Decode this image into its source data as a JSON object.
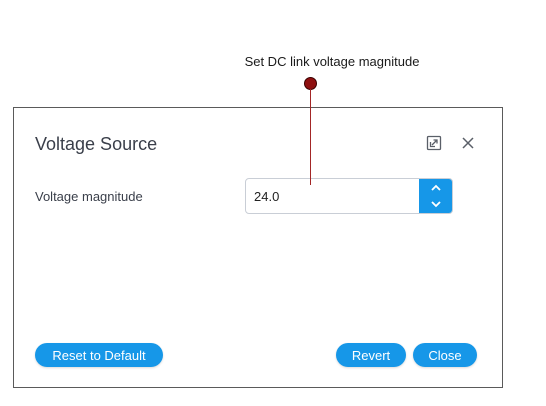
{
  "annotation": {
    "text": "Set DC link voltage magnitude",
    "marker_color": "#8e0f0f"
  },
  "dialog": {
    "title": "Voltage Source",
    "expand_icon": "expand-icon",
    "close_icon": "close-icon"
  },
  "field": {
    "label": "Voltage magnitude",
    "value": "24.0",
    "increment_icon": "chevron-up-icon",
    "decrement_icon": "chevron-down-icon"
  },
  "footer": {
    "reset_label": "Reset to Default",
    "revert_label": "Revert",
    "close_label": "Close"
  },
  "colors": {
    "accent": "#1697e8",
    "title_text": "#3a3f4a",
    "border": "#5a5a5a"
  }
}
